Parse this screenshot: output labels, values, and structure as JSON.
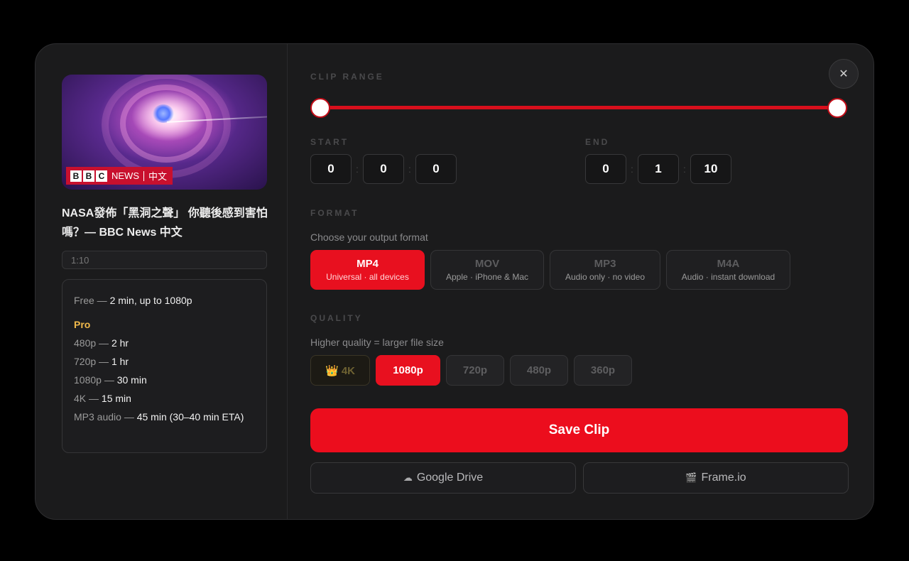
{
  "video": {
    "badge_brand": [
      "B",
      "B",
      "C"
    ],
    "badge_news": "NEWS",
    "badge_lang": "中文",
    "title": "NASA發佈「黑洞之聲」 你聽後感到害怕嗎？— BBC News 中文",
    "duration": "1:10"
  },
  "limits": {
    "free_label": "Free —",
    "free_value": "2 min, up to 1080p",
    "pro_label": "Pro",
    "rows": [
      {
        "label": "480p —",
        "value": "2 hr"
      },
      {
        "label": "720p —",
        "value": "1 hr"
      },
      {
        "label": "1080p —",
        "value": "30 min"
      },
      {
        "label": "4K —",
        "value": "15 min"
      },
      {
        "label": "MP3 audio —",
        "value": "45 min (30–40 min ETA)"
      }
    ]
  },
  "close_label": "✕",
  "clip_range": {
    "label": "CLIP RANGE",
    "start_fraction": 0.0,
    "end_fraction": 1.0
  },
  "start": {
    "label": "START",
    "h": "0",
    "m": "0",
    "s": "0"
  },
  "end": {
    "label": "END",
    "h": "0",
    "m": "1",
    "s": "10"
  },
  "time_separator": ":",
  "format": {
    "label": "FORMAT",
    "hint": "Choose your output format",
    "options": [
      {
        "name": "MP4",
        "desc": "Universal · all devices",
        "active": true
      },
      {
        "name": "MOV",
        "desc": "Apple · iPhone & Mac",
        "active": false
      },
      {
        "name": "MP3",
        "desc": "Audio only · no video",
        "active": false
      },
      {
        "name": "M4A",
        "desc": "Audio · instant download",
        "active": false
      }
    ]
  },
  "quality": {
    "label": "QUALITY",
    "hint": "Higher quality = larger file size",
    "options": [
      {
        "label": "👑 4K",
        "active": false
      },
      {
        "label": "1080p",
        "active": true
      },
      {
        "label": "720p",
        "active": false
      },
      {
        "label": "480p",
        "active": false
      },
      {
        "label": "360p",
        "active": false
      }
    ]
  },
  "save_label": "Save Clip",
  "google_drive": {
    "icon": "☁",
    "label": "Google Drive"
  },
  "frameio": {
    "icon": "🎬",
    "label": "Frame.io"
  },
  "colors": {
    "accent": "#ec0d1d",
    "pro": "#f0b94b",
    "background": "#1b1b1c"
  }
}
